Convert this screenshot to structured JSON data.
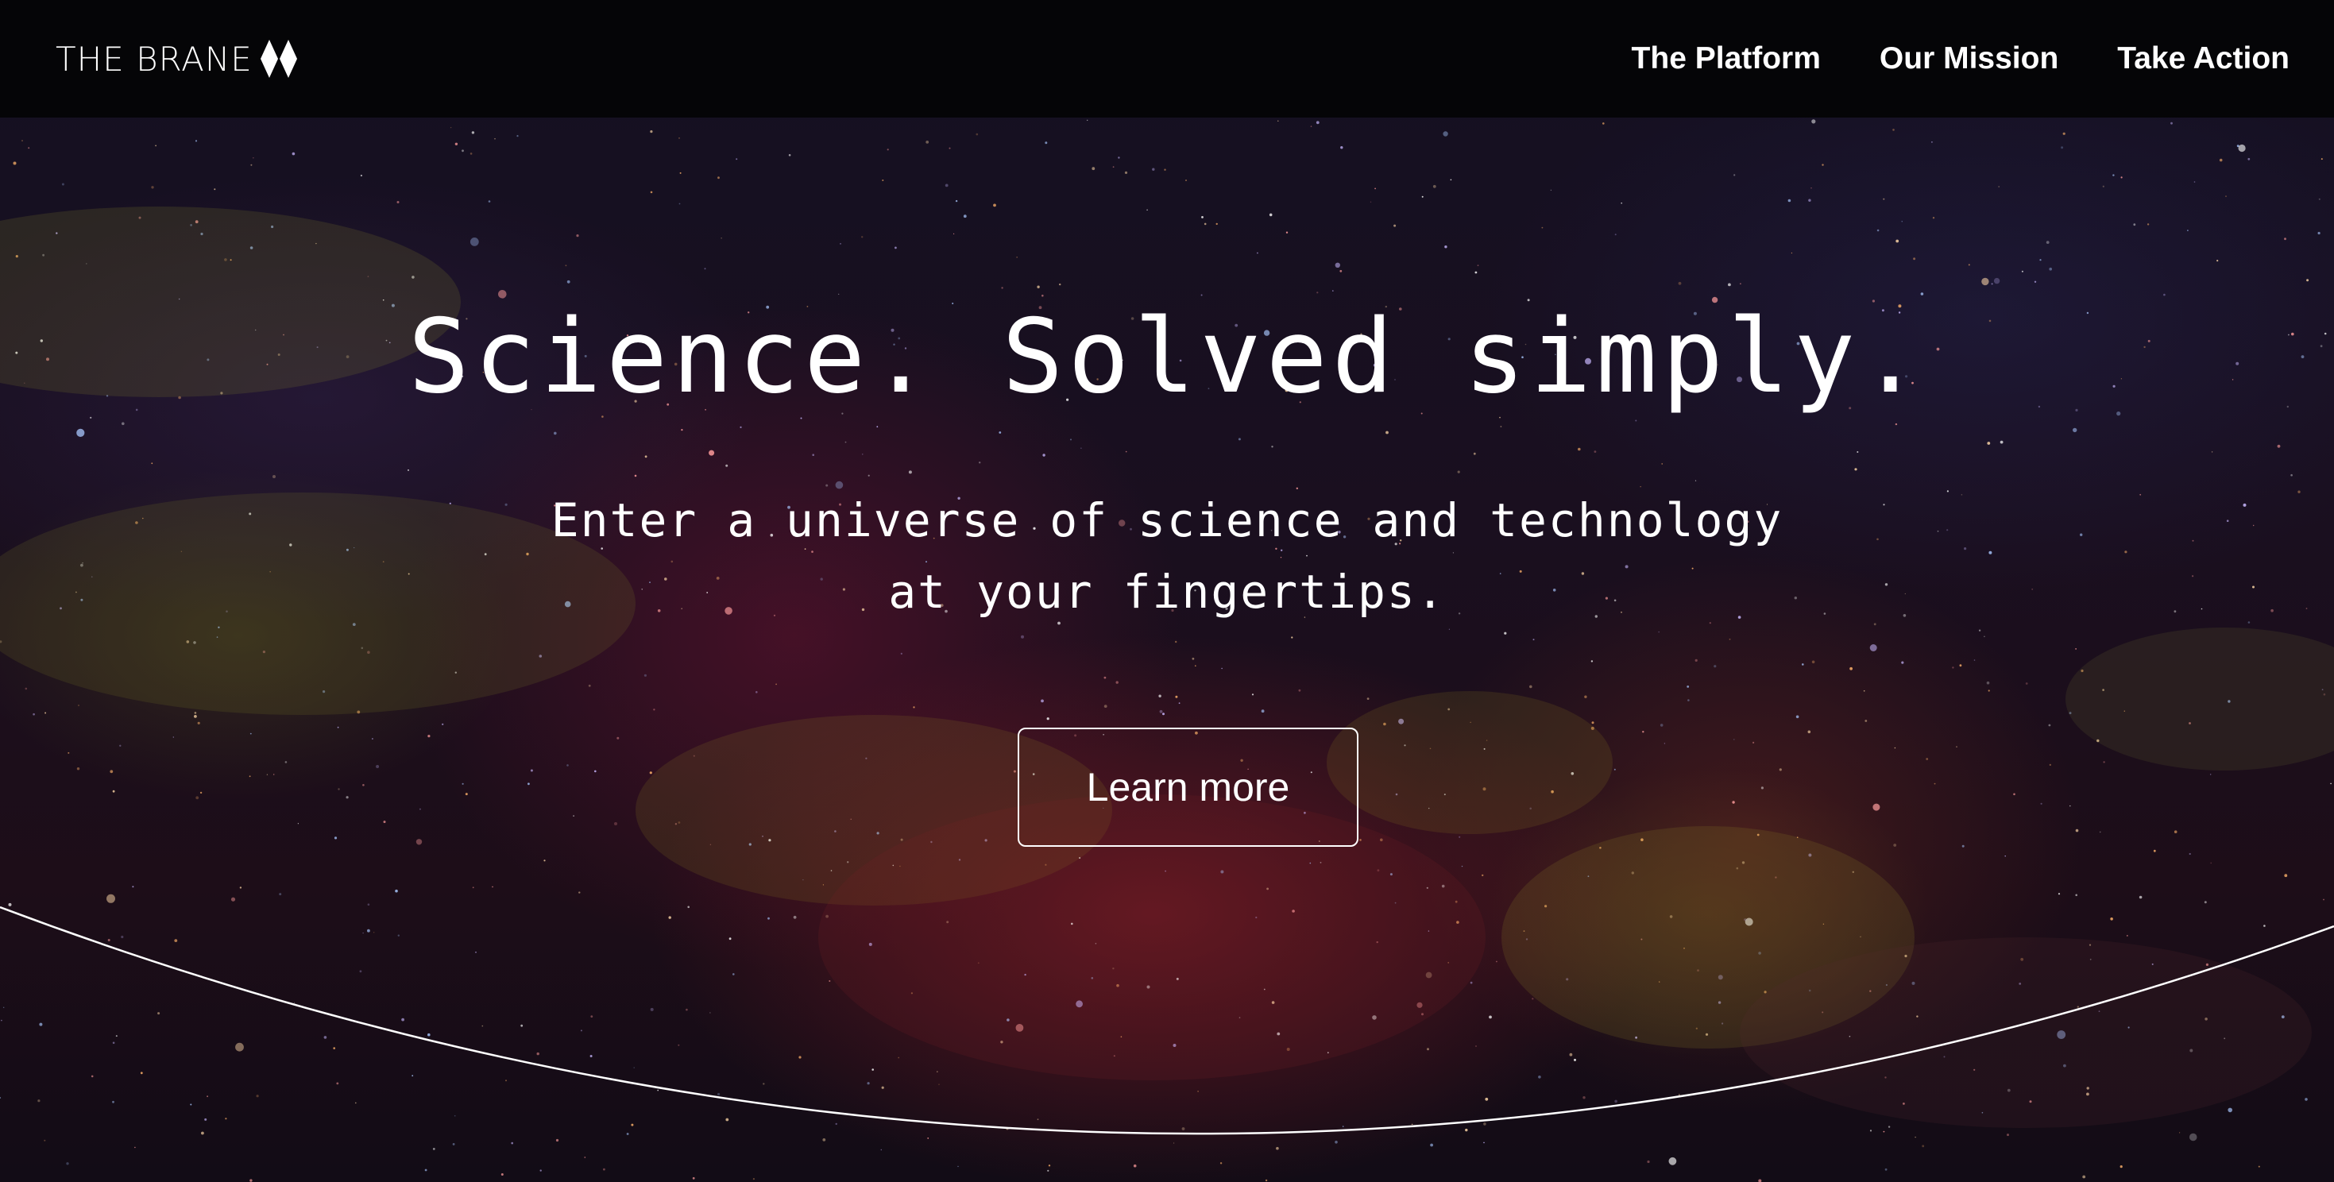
{
  "brand": {
    "name": "THE BRANE",
    "logo_icon": "diamond-pair-icon"
  },
  "nav": {
    "items": [
      {
        "label": "The Platform"
      },
      {
        "label": "Our Mission"
      },
      {
        "label": "Take Action"
      }
    ]
  },
  "hero": {
    "title": "Science. Solved simply.",
    "subtitle_line1": "Enter a universe of science and technology",
    "subtitle_line2": "at your fingertips.",
    "cta_label": "Learn more"
  },
  "colors": {
    "topbar_bg": "#050507",
    "text": "#ffffff",
    "background_base": "#141022"
  }
}
